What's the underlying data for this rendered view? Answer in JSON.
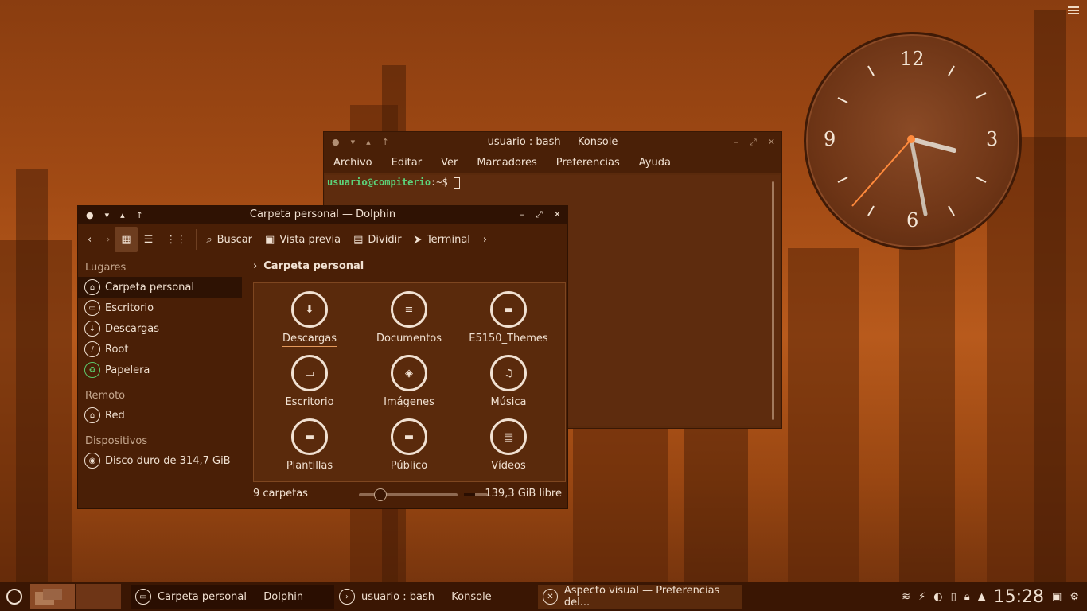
{
  "desktop": {
    "clock_numbers": [
      "12",
      "3",
      "6",
      "9"
    ]
  },
  "konsole": {
    "title": "usuario : bash — Konsole",
    "menu": [
      "Archivo",
      "Editar",
      "Ver",
      "Marcadores",
      "Preferencias",
      "Ayuda"
    ],
    "prompt_user": "usuario@compiterio",
    "prompt_path": ":~$",
    "cursor": " "
  },
  "dolphin": {
    "title": "Carpeta personal — Dolphin",
    "toolbar": {
      "search": "Buscar",
      "preview": "Vista previa",
      "split": "Dividir",
      "terminal": "Terminal"
    },
    "sidebar": {
      "places_head": "Lugares",
      "places": [
        "Carpeta personal",
        "Escritorio",
        "Descargas",
        "Root",
        "Papelera"
      ],
      "remote_head": "Remoto",
      "remote": [
        "Red"
      ],
      "devices_head": "Dispositivos",
      "devices": [
        "Disco duro de 314,7 GiB"
      ]
    },
    "breadcrumb": "Carpeta personal",
    "folders": [
      "Descargas",
      "Documentos",
      "E5150_Themes",
      "Escritorio",
      "Imágenes",
      "Música",
      "Plantillas",
      "Público",
      "Vídeos"
    ],
    "status": {
      "count": "9 carpetas",
      "free": "139,3 GiB libre"
    }
  },
  "taskbar": {
    "tasks": [
      "Carpeta personal — Dolphin",
      "usuario : bash — Konsole",
      "Aspecto visual  — Preferencias del..."
    ],
    "time": "15:28"
  }
}
